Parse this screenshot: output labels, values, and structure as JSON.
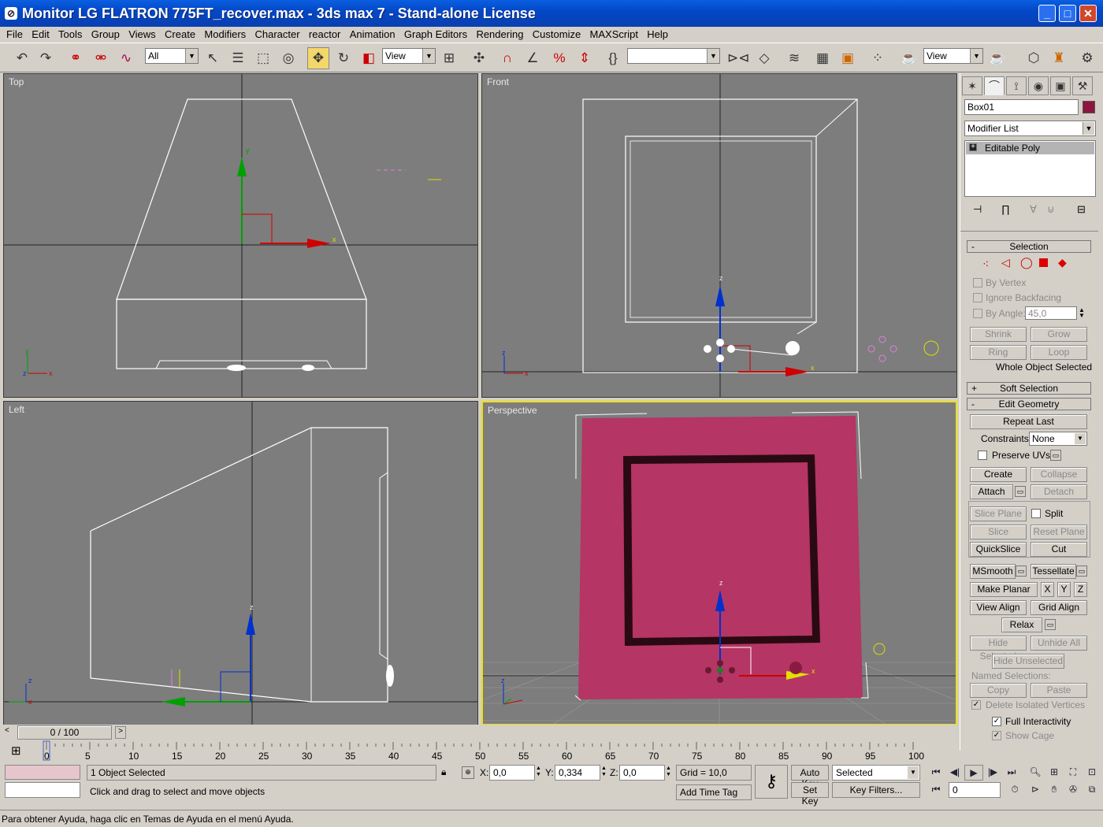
{
  "window": {
    "title": "Monitor LG FLATRON 775FT_recover.max - 3ds max 7  - Stand-alone License",
    "minimize": "_",
    "maximize": "□",
    "close": "✕"
  },
  "menu": [
    "File",
    "Edit",
    "Tools",
    "Group",
    "Views",
    "Create",
    "Modifiers",
    "Character",
    "reactor",
    "Animation",
    "Graph Editors",
    "Rendering",
    "Customize",
    "MAXScript",
    "Help"
  ],
  "toolbar": {
    "selection_filter": "All",
    "ref_coord_1": "View",
    "named_selection": "",
    "ref_coord_2": "View",
    "icons": [
      "undo-icon",
      "redo-icon",
      "select-link-icon",
      "unlink-icon",
      "bind-spacewarp-icon",
      "select-object-icon",
      "select-by-name-icon",
      "rect-region-icon",
      "window-crossing-icon",
      "move-icon",
      "rotate-icon",
      "scale-icon",
      "pivot-icon",
      "manipulate-icon",
      "snap-3d-icon",
      "angle-snap-icon",
      "percent-snap-icon",
      "spinner-snap-icon",
      "edit-named-sel-icon",
      "mirror-icon",
      "align-icon",
      "layer-manager-icon",
      "curve-editor-icon",
      "schematic-icon",
      "material-editor-icon",
      "render-scene-icon",
      "quick-render-icon"
    ]
  },
  "viewports": {
    "top": "Top",
    "front": "Front",
    "left": "Left",
    "perspective": "Perspective"
  },
  "colors": {
    "viewport_bg": "#7d7d7d",
    "active_border": "#f0e000",
    "object_color": "#b03060",
    "monitor_fill": "#b53564",
    "axis_x": "#d00000",
    "axis_y": "#00a000",
    "axis_z": "#0030d0"
  },
  "command_panel": {
    "tabs": [
      "create-icon",
      "modify-icon",
      "hierarchy-icon",
      "motion-icon",
      "display-icon",
      "utilities-icon"
    ],
    "object_name": "Box01",
    "modifier_list": "Modifier List",
    "stack_item": "Editable Poly",
    "stack_expand": "+",
    "selection": {
      "header": "Selection",
      "toggle": "-",
      "by_vertex": "By Vertex",
      "ignore_backfacing": "Ignore Backfacing",
      "by_angle": "By Angle:",
      "angle_value": "45,0",
      "shrink": "Shrink",
      "grow": "Grow",
      "ring": "Ring",
      "loop": "Loop",
      "status": "Whole Object Selected"
    },
    "soft_selection": {
      "header": "Soft Selection",
      "toggle": "+"
    },
    "edit_geometry": {
      "header": "Edit Geometry",
      "toggle": "-",
      "repeat_last": "Repeat Last",
      "constraints_label": "Constraints:",
      "constraints_value": "None",
      "preserve_uvs": "Preserve UVs",
      "create": "Create",
      "collapse": "Collapse",
      "attach": "Attach",
      "detach": "Detach",
      "slice_plane": "Slice Plane",
      "split": "Split",
      "slice": "Slice",
      "reset_plane": "Reset Plane",
      "quickslice": "QuickSlice",
      "cut": "Cut",
      "msmooth": "MSmooth",
      "tessellate": "Tessellate",
      "make_planar": "Make Planar",
      "x": "X",
      "y": "Y",
      "z": "Z",
      "view_align": "View Align",
      "grid_align": "Grid Align",
      "relax": "Relax",
      "hide_selected": "Hide Selected",
      "unhide_all": "Unhide All",
      "hide_unselected": "Hide Unselected",
      "named_selections": "Named Selections:",
      "copy": "Copy",
      "paste": "Paste",
      "delete_isolated": "Delete Isolated Vertices",
      "full_interactivity": "Full Interactivity",
      "show_cage": "Show Cage"
    }
  },
  "timeline": {
    "slider_label": "0 / 100",
    "ticks": [
      "0",
      "5",
      "10",
      "15",
      "20",
      "25",
      "30",
      "35",
      "40",
      "45",
      "50",
      "55",
      "60",
      "65",
      "70",
      "75",
      "80",
      "85",
      "90",
      "95",
      "100"
    ],
    "current_frame": 0,
    "total_frames": 100
  },
  "status": {
    "selection_text": "1 Object Selected",
    "prompt_text": "Click and drag to select and move objects",
    "x_label": "X:",
    "x_value": "0,0",
    "y_label": "Y:",
    "y_value": "0,334",
    "z_label": "Z:",
    "z_value": "0,0",
    "grid": "Grid = 10,0",
    "add_time_tag": "Add Time Tag",
    "auto_key": "Auto Key",
    "set_key": "Set Key",
    "key_mode": "Selected",
    "key_filters": "Key Filters...",
    "frame_field": "0"
  },
  "help_text": "Para obtener Ayuda, haga clic en Temas de Ayuda en el menú Ayuda."
}
